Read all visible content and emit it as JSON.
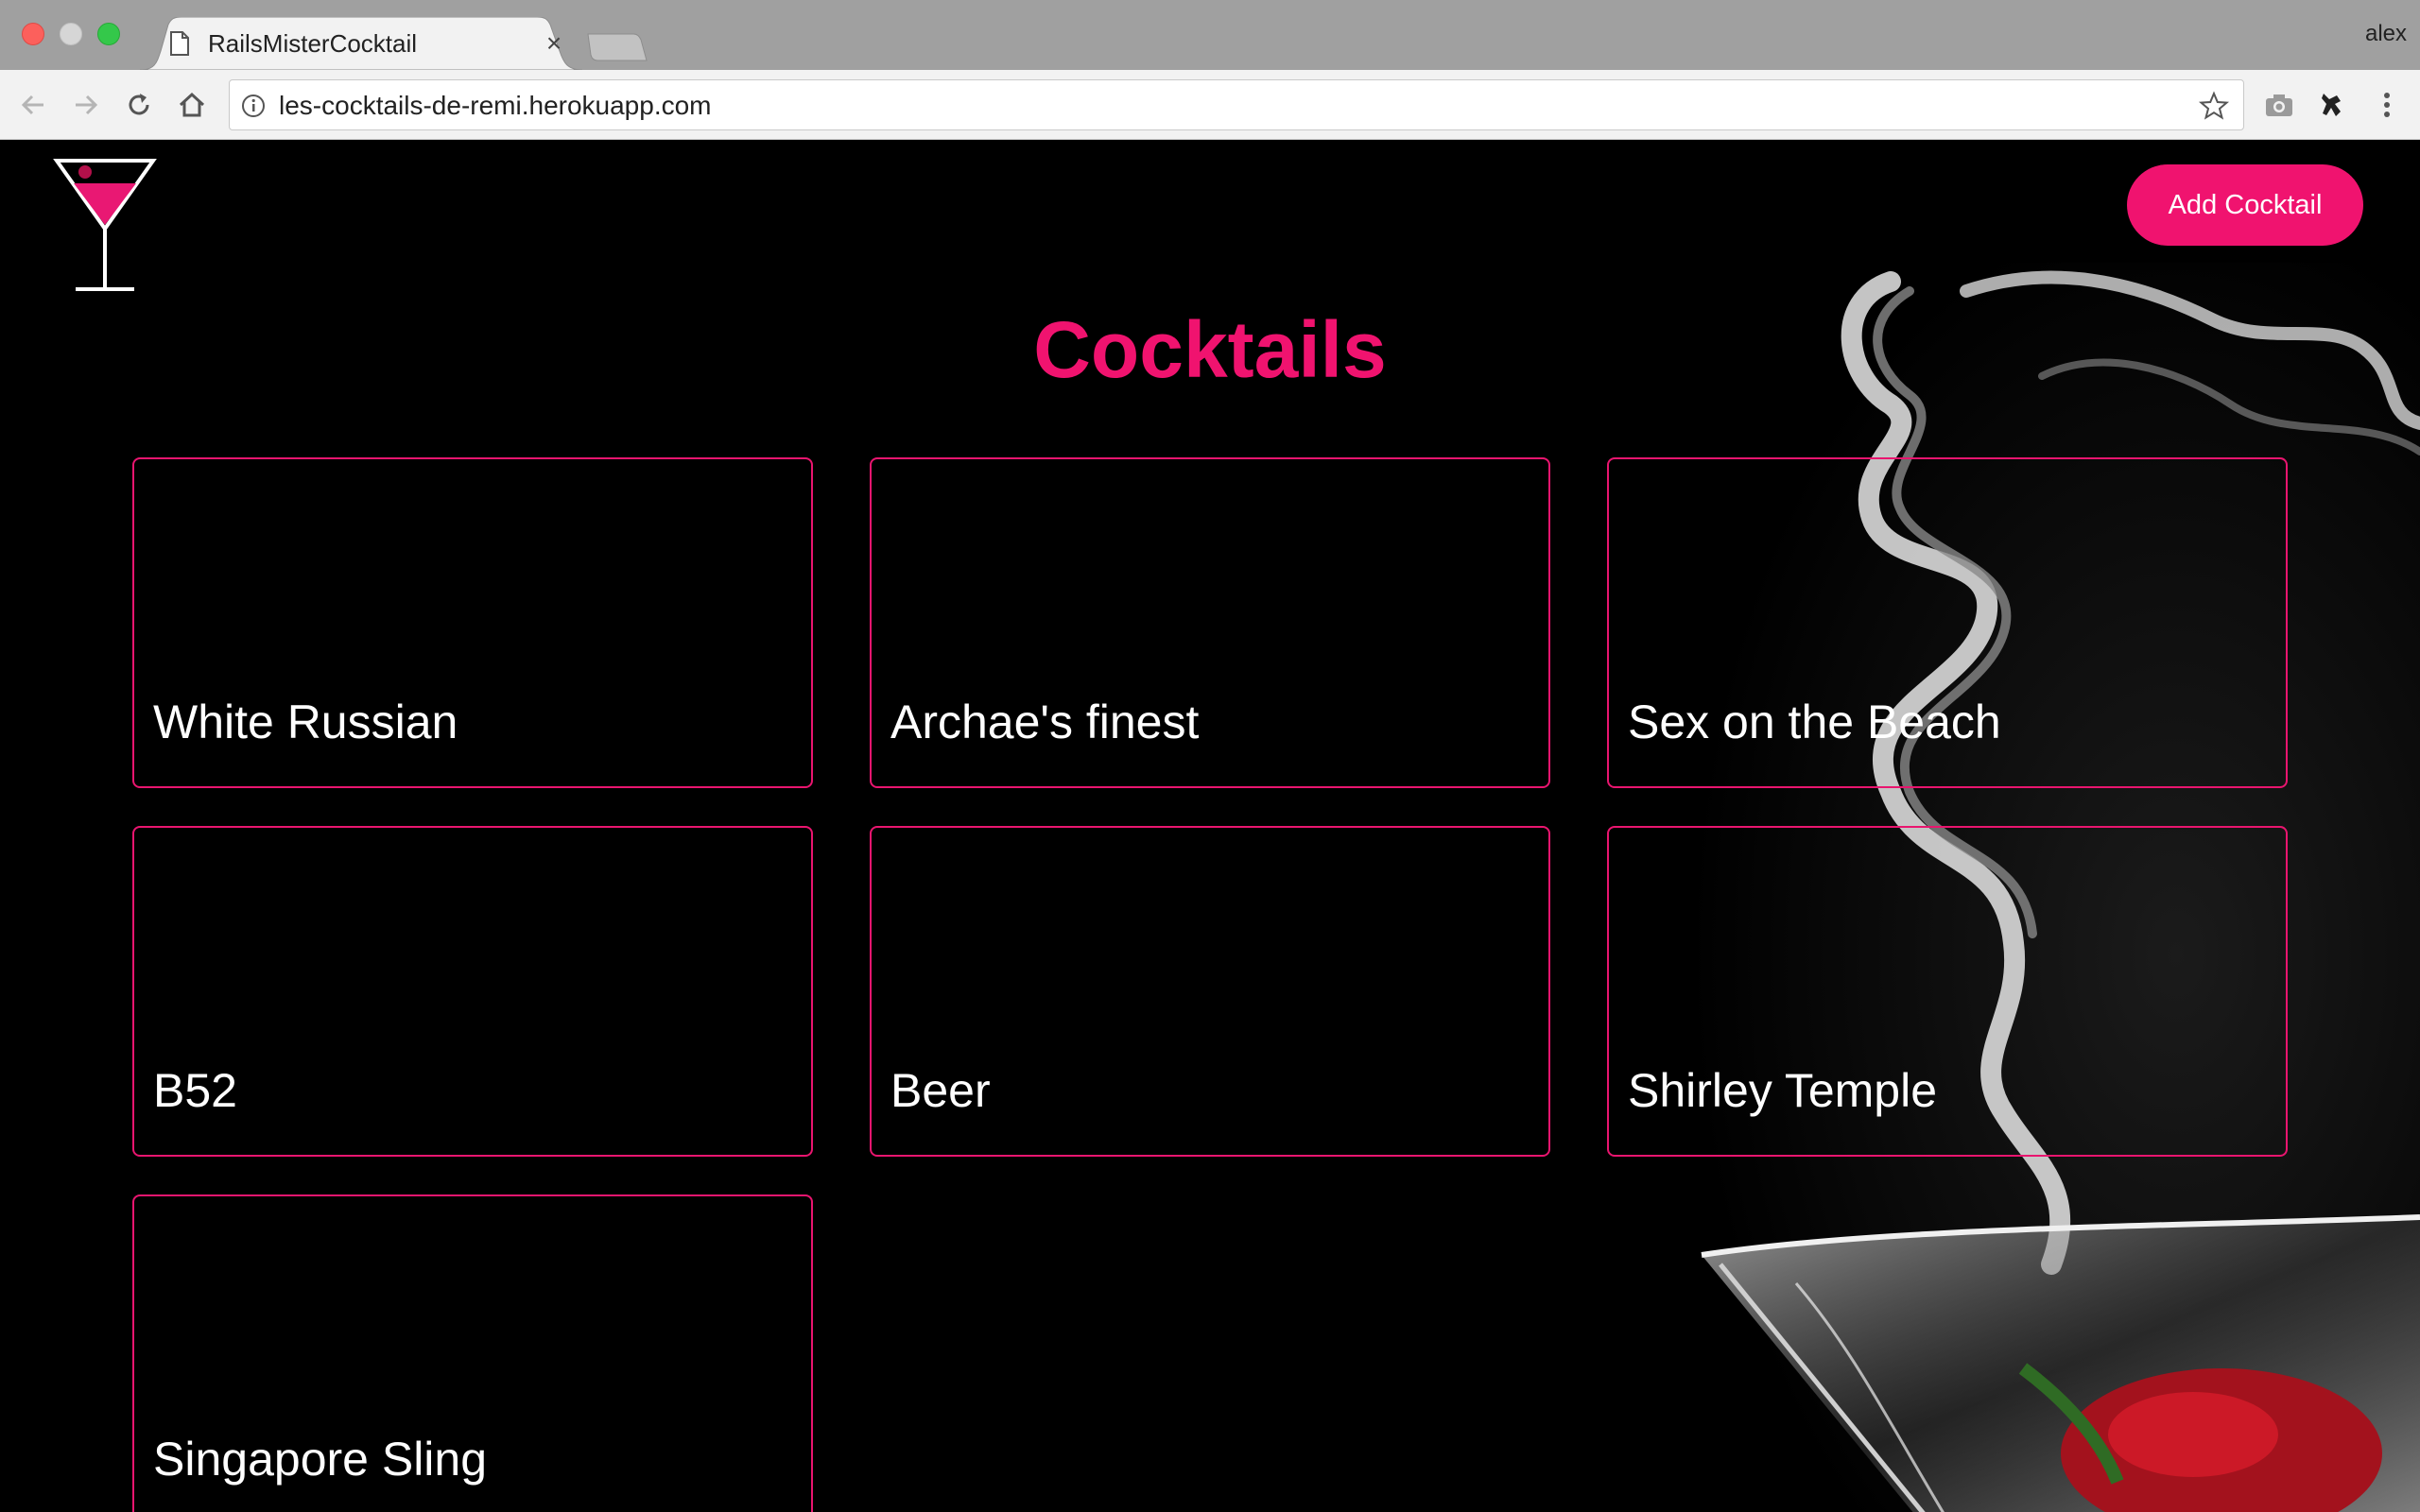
{
  "browser": {
    "tab": {
      "title": "RailsMisterCocktail",
      "close": "×"
    },
    "profile": "alex",
    "address": {
      "url": "les-cocktails-de-remi.herokuapp.com"
    }
  },
  "header": {
    "add_button_label": "Add Cocktail"
  },
  "main": {
    "title": "Cocktails",
    "cocktails": [
      {
        "name": "White Russian"
      },
      {
        "name": "Archae's finest"
      },
      {
        "name": "Sex on the Beach"
      },
      {
        "name": "B52"
      },
      {
        "name": "Beer"
      },
      {
        "name": "Shirley Temple"
      },
      {
        "name": "Singapore Sling"
      }
    ]
  },
  "colors": {
    "accent": "#f0136f",
    "background": "#000000",
    "card_border": "#e9156f",
    "text": "#ffffff"
  },
  "icons": {
    "logo": "martini-glass-icon",
    "tab": "page-icon",
    "back": "back-arrow-icon",
    "forward": "forward-arrow-icon",
    "reload": "reload-icon",
    "home": "home-icon",
    "info": "info-icon",
    "bookmark": "star-icon",
    "camera": "camera-icon",
    "extension": "extension-icon",
    "menu": "kebab-menu-icon"
  }
}
